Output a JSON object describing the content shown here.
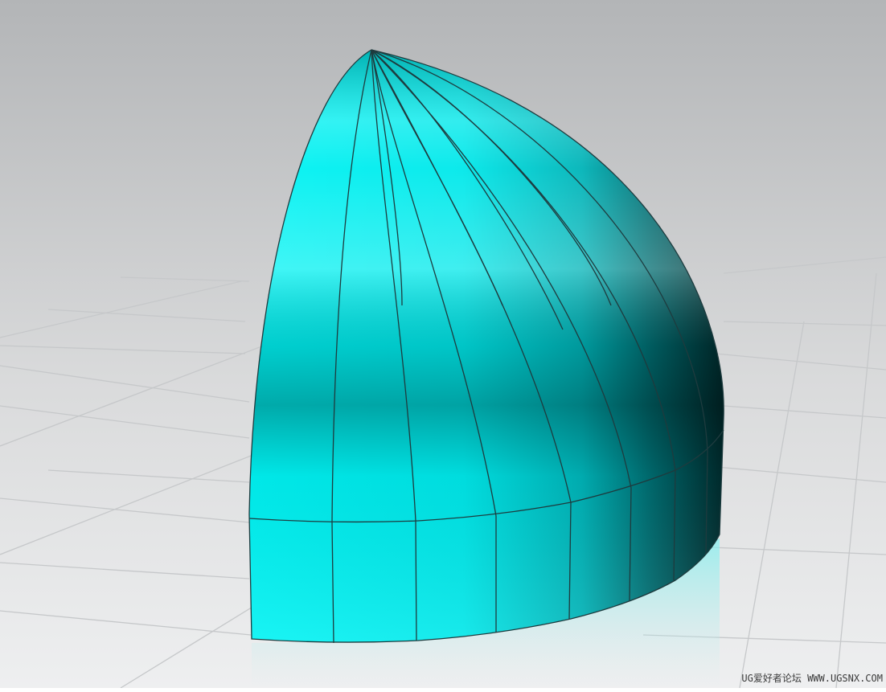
{
  "viewport": {
    "background_top": "#b4b6b8",
    "background_bottom": "#ecedee",
    "model_color": "#00ffff",
    "model_shadow_color": "#004448",
    "edge_color": "#1e3b3e"
  },
  "watermark": {
    "text": "UG爱好者论坛 WWW.UGSNX.COM"
  }
}
